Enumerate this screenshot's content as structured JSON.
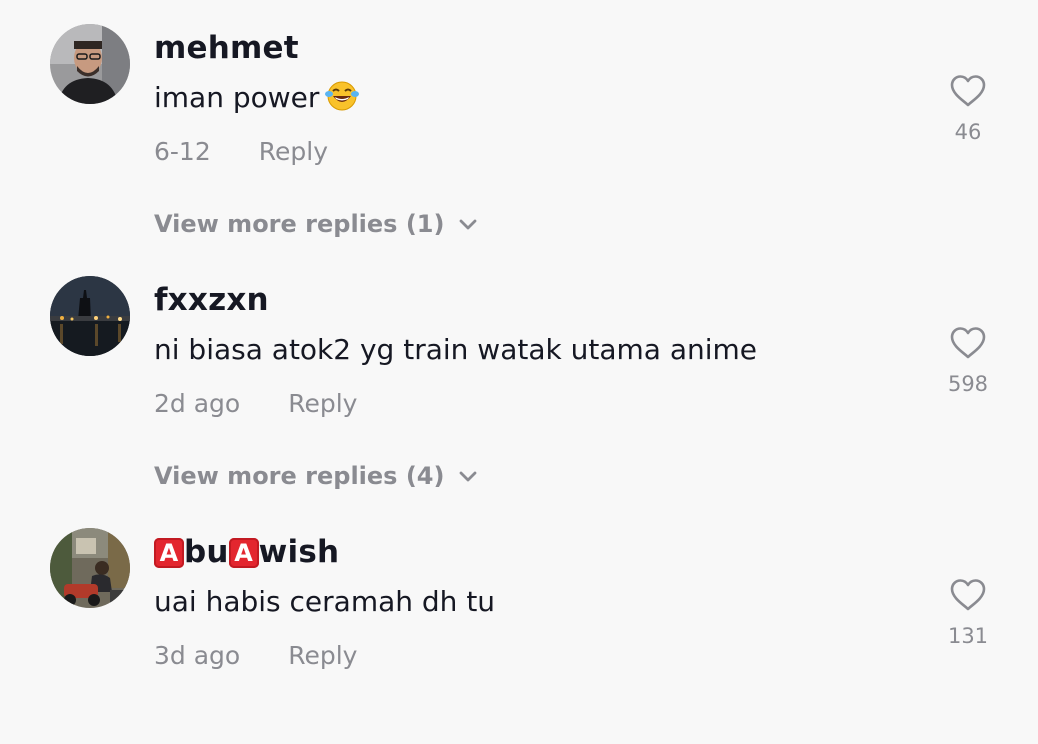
{
  "comments": [
    {
      "username": "mehmet",
      "text": "iman power",
      "emoji": "laughing-tears-emoji",
      "date": "6-12",
      "reply_label": "Reply",
      "likes": "46",
      "view_more": "View more replies (1)"
    },
    {
      "username": "fxxzxn",
      "text": "ni biasa atok2 yg train watak utama anime",
      "date": "2d ago",
      "reply_label": "Reply",
      "likes": "598",
      "view_more": "View more replies (4)"
    },
    {
      "username_parts": [
        "A",
        "bu",
        "A",
        "wish"
      ],
      "text": "uai habis ceramah dh tu",
      "date": "3d ago",
      "reply_label": "Reply",
      "likes": "131"
    }
  ],
  "colors": {
    "background": "#f8f8f8",
    "primary_text": "#161823",
    "secondary_text": "#8a8b91",
    "badge_red": "#e3262f"
  },
  "icons": {
    "like": "heart-outline-icon",
    "expand": "chevron-down-icon"
  }
}
